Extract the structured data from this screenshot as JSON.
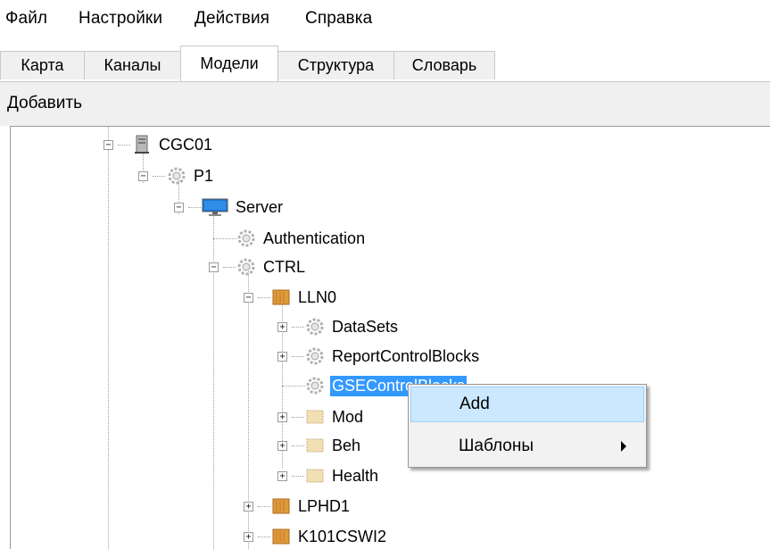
{
  "menubar": {
    "items": [
      "Файл",
      "Настройки",
      "Действия",
      "Справка"
    ]
  },
  "tabs": {
    "items": [
      "Карта",
      "Каналы",
      "Модели",
      "Структура",
      "Словарь"
    ],
    "active": "Модели"
  },
  "toolbar": {
    "add_label": "Добавить"
  },
  "tree": {
    "nodes": [
      {
        "label": "CGC01",
        "icon": "server-tower-icon",
        "expander": "minus"
      },
      {
        "label": "P1",
        "icon": "gear-icon",
        "expander": "minus"
      },
      {
        "label": "Server",
        "icon": "monitor-icon",
        "expander": "minus"
      },
      {
        "label": "Authentication",
        "icon": "gear-icon",
        "expander": "none"
      },
      {
        "label": "CTRL",
        "icon": "gear-icon",
        "expander": "minus"
      },
      {
        "label": "LLN0",
        "icon": "logical-node-icon",
        "expander": "minus"
      },
      {
        "label": "DataSets",
        "icon": "gear-icon",
        "expander": "plus"
      },
      {
        "label": "ReportControlBlocks",
        "icon": "gear-icon",
        "expander": "plus"
      },
      {
        "label": "GSEControlBlocks",
        "icon": "gear-icon",
        "expander": "none",
        "selected": true
      },
      {
        "label": "Mod",
        "icon": "data-object-icon",
        "expander": "plus"
      },
      {
        "label": "Beh",
        "icon": "data-object-icon",
        "expander": "plus"
      },
      {
        "label": "Health",
        "icon": "data-object-icon",
        "expander": "plus"
      },
      {
        "label": "LPHD1",
        "icon": "logical-node-icon",
        "expander": "plus"
      },
      {
        "label": "K101CSWI2",
        "icon": "logical-node-icon",
        "expander": "plus"
      }
    ]
  },
  "context_menu": {
    "items": [
      {
        "label": "Add",
        "highlighted": true
      },
      {
        "label": "Шаблоны",
        "submenu": true
      }
    ]
  },
  "colors": {
    "selection": "#3399ff",
    "menu_highlight": "#cce8ff",
    "menu_highlight_border": "#99d1ff",
    "monitor": "#1e73d2",
    "logical_node": "#e09a3c",
    "data_object": "#f2dfb4"
  }
}
